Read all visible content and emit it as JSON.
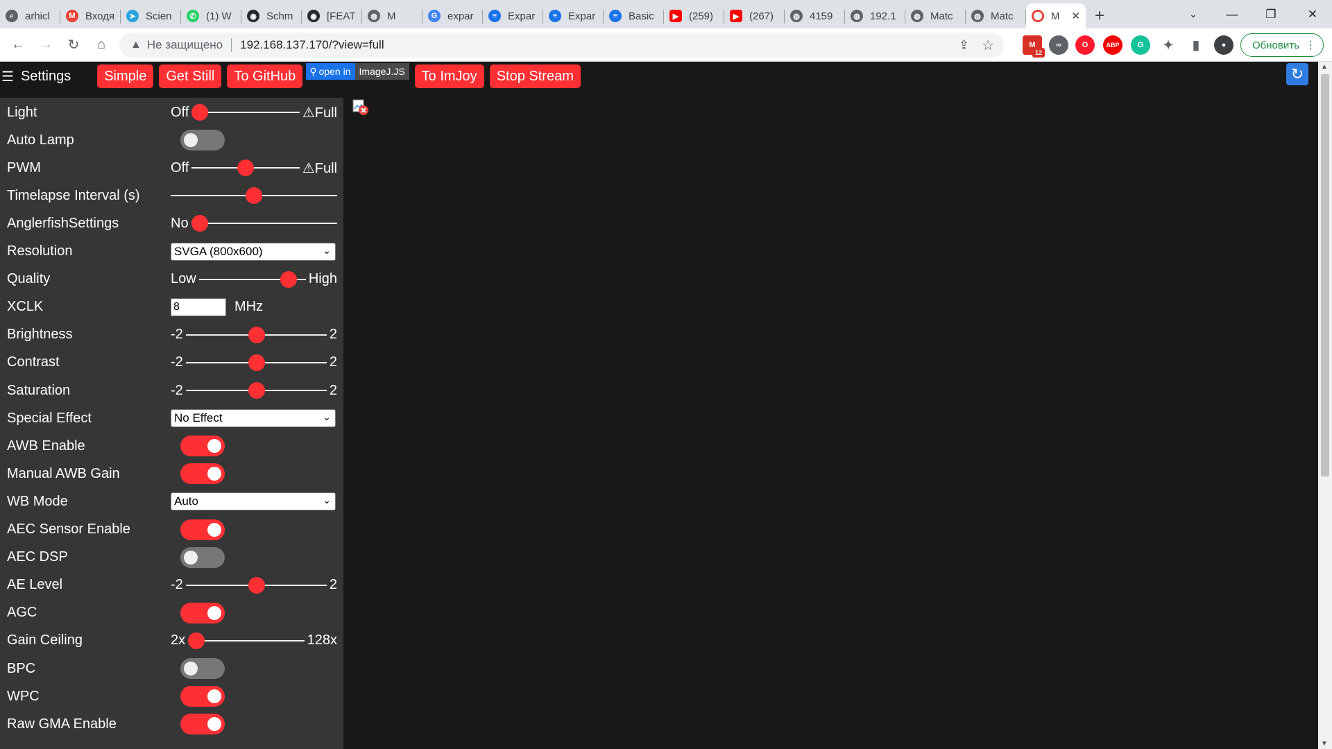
{
  "browser": {
    "tabs": [
      {
        "title": "arhicl",
        "icon": "search-icon",
        "color": "#5f6368"
      },
      {
        "title": "Входя",
        "icon": "gmail-icon",
        "color": "#ea4335"
      },
      {
        "title": "Scien",
        "icon": "telegram-icon",
        "color": "#2aa3df"
      },
      {
        "title": "(1) W",
        "icon": "whatsapp-icon",
        "color": "#25d366"
      },
      {
        "title": "Schm",
        "icon": "github-icon",
        "color": "#24292f"
      },
      {
        "title": "[FEAT",
        "icon": "github-icon",
        "color": "#24292f"
      },
      {
        "title": "M",
        "icon": "globe-icon",
        "color": "#5f6368"
      },
      {
        "title": "expar",
        "icon": "google-icon",
        "color": "#4285f4"
      },
      {
        "title": "Expar",
        "icon": "doc-icon",
        "color": "#1a73e8"
      },
      {
        "title": "Expar",
        "icon": "doc-icon",
        "color": "#1a73e8"
      },
      {
        "title": "Basic",
        "icon": "doc-icon",
        "color": "#1a73e8"
      },
      {
        "title": "(259)",
        "icon": "youtube-icon",
        "color": "#ff0000"
      },
      {
        "title": "(267)",
        "icon": "youtube-icon",
        "color": "#ff0000"
      },
      {
        "title": "4159",
        "icon": "globe-icon",
        "color": "#5f6368"
      },
      {
        "title": "192.1",
        "icon": "globe-icon",
        "color": "#5f6368"
      },
      {
        "title": "Matc",
        "icon": "globe-icon",
        "color": "#5f6368"
      },
      {
        "title": "Matc",
        "icon": "globe-icon",
        "color": "#5f6368"
      }
    ],
    "active_tab": {
      "title": "M",
      "icon": "camera-icon"
    },
    "security_label": "Не защищено",
    "url": "192.168.137.170/?view=full",
    "update_label": "Обновить",
    "gmail_badge": "12"
  },
  "header": {
    "menu_label": "Settings",
    "buttons": {
      "simple": "Simple",
      "get_still": "Get Still",
      "to_github": "To GitHub",
      "to_imjoy": "To ImJoy",
      "stop_stream": "Stop Stream"
    },
    "imagej": {
      "open_in": "open in",
      "name": "ImageJ.JS"
    }
  },
  "settings": {
    "light": {
      "label": "Light",
      "min": "Off",
      "max": "⚠Full",
      "value": 0.0
    },
    "auto_lamp": {
      "label": "Auto Lamp",
      "on": false
    },
    "pwm": {
      "label": "PWM",
      "min": "Off",
      "max": "⚠Full",
      "value": 0.5
    },
    "timelapse": {
      "label": "Timelapse Interval (s)",
      "value": 0.5
    },
    "anglerfish": {
      "label": "AnglerfishSettings",
      "min": "No",
      "value": 0.0
    },
    "resolution": {
      "label": "Resolution",
      "selected": "SVGA (800x600)"
    },
    "quality": {
      "label": "Quality",
      "min": "Low",
      "max": "High",
      "value": 0.9
    },
    "xclk": {
      "label": "XCLK",
      "value": "8",
      "unit": "MHz"
    },
    "brightness": {
      "label": "Brightness",
      "min": "-2",
      "max": "2",
      "value": 0.5
    },
    "contrast": {
      "label": "Contrast",
      "min": "-2",
      "max": "2",
      "value": 0.5
    },
    "saturation": {
      "label": "Saturation",
      "min": "-2",
      "max": "2",
      "value": 0.5
    },
    "special_effect": {
      "label": "Special Effect",
      "selected": "No Effect"
    },
    "awb_enable": {
      "label": "AWB Enable",
      "on": true
    },
    "manual_awb_gain": {
      "label": "Manual AWB Gain",
      "on": true
    },
    "wb_mode": {
      "label": "WB Mode",
      "selected": "Auto"
    },
    "aec_sensor": {
      "label": "AEC Sensor Enable",
      "on": true
    },
    "aec_dsp": {
      "label": "AEC DSP",
      "on": false
    },
    "ae_level": {
      "label": "AE Level",
      "min": "-2",
      "max": "2",
      "value": 0.5
    },
    "agc": {
      "label": "AGC",
      "on": true
    },
    "gain_ceiling": {
      "label": "Gain Ceiling",
      "min": "2x",
      "max": "128x",
      "value": 0.0
    },
    "bpc": {
      "label": "BPC",
      "on": false
    },
    "wpc": {
      "label": "WPC",
      "on": true
    },
    "raw_gma": {
      "label": "Raw GMA Enable",
      "on": true
    }
  },
  "colors": {
    "accent": "#ff3034",
    "sidebar": "#363636",
    "background": "#181818"
  }
}
